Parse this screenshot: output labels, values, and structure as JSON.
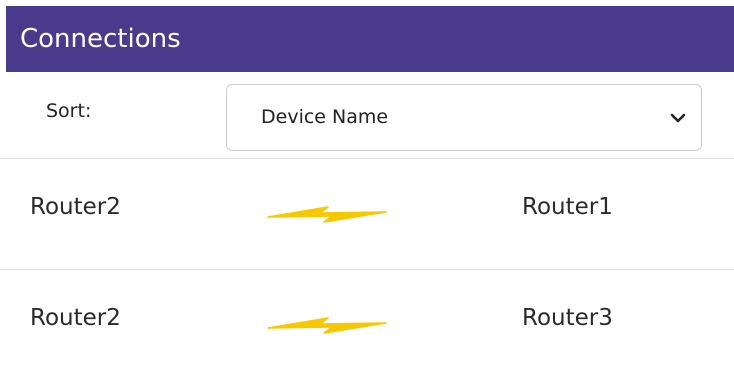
{
  "panel": {
    "title": "Connections"
  },
  "sort": {
    "label": "Sort:",
    "selected": "Device Name",
    "chevron_icon": "chevron-down-icon"
  },
  "connections": [
    {
      "device_a": "Router2",
      "device_b": "Router1",
      "link_icon": "lightning-bolt-icon"
    },
    {
      "device_a": "Router2",
      "device_b": "Router3",
      "link_icon": "lightning-bolt-icon"
    }
  ],
  "colors": {
    "header_bg": "#4a3a8c",
    "header_text": "#ffffff",
    "link": "#f5c800",
    "divider": "#e2e2e2"
  }
}
